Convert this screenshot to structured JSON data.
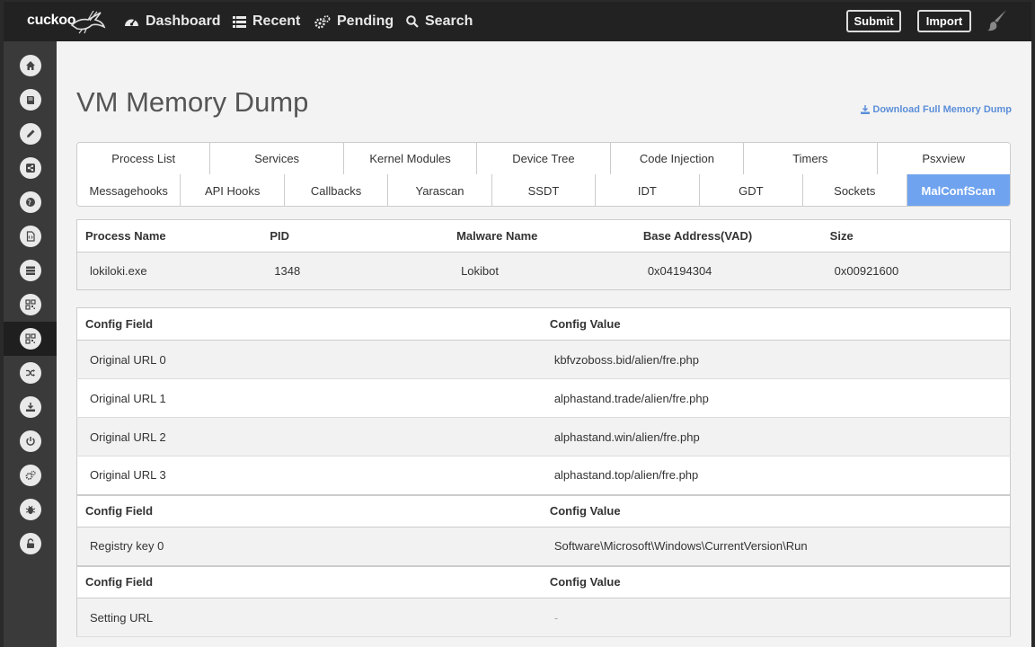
{
  "brand": {
    "name": "cuckoo"
  },
  "nav": {
    "items": [
      {
        "label": "Dashboard",
        "icon": "tachometer-icon"
      },
      {
        "label": "Recent",
        "icon": "list-icon"
      },
      {
        "label": "Pending",
        "icon": "cogs-icon"
      },
      {
        "label": "Search",
        "icon": "search-icon"
      }
    ],
    "submit_label": "Submit",
    "import_label": "Import"
  },
  "sidebar": {
    "items": [
      {
        "icon": "home-icon"
      },
      {
        "icon": "book-icon"
      },
      {
        "icon": "pencil-icon"
      },
      {
        "icon": "share-icon"
      },
      {
        "icon": "globe-icon"
      },
      {
        "icon": "file-code-icon"
      },
      {
        "icon": "server-icon"
      },
      {
        "icon": "qrcode-icon"
      },
      {
        "icon": "qrcode-icon",
        "active": true
      },
      {
        "icon": "random-icon"
      },
      {
        "icon": "download-icon"
      },
      {
        "icon": "power-icon"
      },
      {
        "icon": "cogs-icon"
      },
      {
        "icon": "bug-icon"
      },
      {
        "icon": "unlock-icon"
      }
    ]
  },
  "page": {
    "title": "VM Memory Dump",
    "download_label": "Download Full Memory Dump"
  },
  "tabs": {
    "row1": [
      "Process List",
      "Services",
      "Kernel Modules",
      "Device Tree",
      "Code Injection",
      "Timers",
      "Psxview"
    ],
    "row2": [
      "Messagehooks",
      "API Hooks",
      "Callbacks",
      "Yarascan",
      "SSDT",
      "IDT",
      "GDT",
      "Sockets",
      "MalConfScan"
    ],
    "active": "MalConfScan"
  },
  "process_table": {
    "headers": [
      "Process Name",
      "PID",
      "Malware Name",
      "Base Address(VAD)",
      "Size"
    ],
    "row": [
      "lokiloki.exe",
      "1348",
      "Lokibot",
      "0x04194304",
      "0x00921600"
    ]
  },
  "config": {
    "header_field": "Config Field",
    "header_value": "Config Value",
    "groups": [
      {
        "rows": [
          [
            "Original URL 0",
            "kbfvzoboss.bid/alien/fre.php"
          ],
          [
            "Original URL 1",
            "alphastand.trade/alien/fre.php"
          ],
          [
            "Original URL 2",
            "alphastand.win/alien/fre.php"
          ],
          [
            "Original URL 3",
            "alphastand.top/alien/fre.php"
          ]
        ]
      },
      {
        "rows": [
          [
            "Registry key 0",
            "Software\\Microsoft\\Windows\\CurrentVersion\\Run"
          ]
        ]
      },
      {
        "rows": [
          [
            "Setting URL",
            "-"
          ]
        ]
      }
    ]
  },
  "colors": {
    "navbar": "#222222",
    "sidebar": "#3a3a3a",
    "accent": "#6fa3ef",
    "link": "#5b8fd9"
  }
}
